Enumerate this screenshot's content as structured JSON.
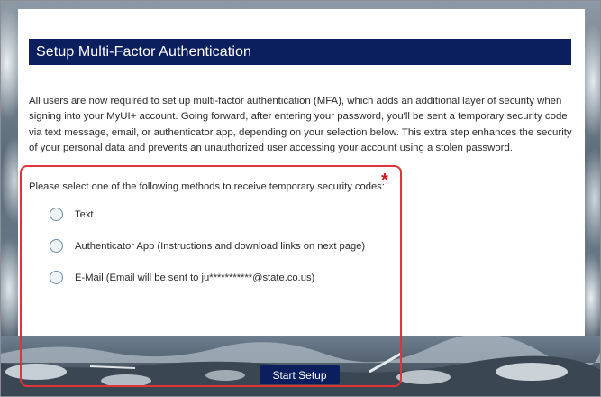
{
  "page": {
    "title": "Setup Multi-Factor Authentication",
    "intro": "All users are now required to set up multi-factor authentication (MFA), which adds an additional layer of security when signing into your MyUI+ account. Going forward, after entering your password, you'll be sent a temporary security code via text message, email, or authenticator app, depending on your selection below. This extra step enhances the security of your personal data and prevents an unauthorized user accessing your account using a stolen password."
  },
  "form": {
    "prompt": "Please select one of the following methods to receive temporary security codes:",
    "required_marker": "*",
    "options": [
      {
        "label": "Text",
        "selected": false
      },
      {
        "label": "Authenticator App (Instructions and download links on next page)",
        "selected": false
      },
      {
        "label": "E-Mail (Email will be sent to ju***********@state.co.us)",
        "selected": false
      }
    ],
    "submit_label": "Start Setup"
  },
  "colors": {
    "title_bar": "#0b1f5e",
    "highlight_border": "#e0343a",
    "required_marker": "#d1191f"
  }
}
